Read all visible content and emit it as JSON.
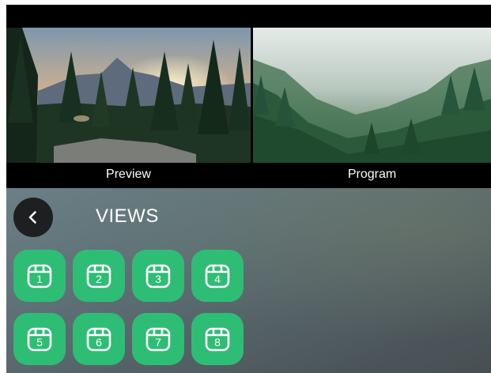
{
  "monitors": {
    "preview_label": "Preview",
    "program_label": "Program"
  },
  "views_panel": {
    "title": "VIEWS",
    "back_icon": "chevron-left-icon",
    "view_icon": "calendar-icon",
    "views": [
      {
        "number": "1"
      },
      {
        "number": "2"
      },
      {
        "number": "3"
      },
      {
        "number": "4"
      },
      {
        "number": "5"
      },
      {
        "number": "6"
      },
      {
        "number": "7"
      },
      {
        "number": "8"
      }
    ]
  },
  "colors": {
    "view_button": "#2ebd74",
    "back_button": "#1e1f20",
    "label_bar": "#000000"
  }
}
